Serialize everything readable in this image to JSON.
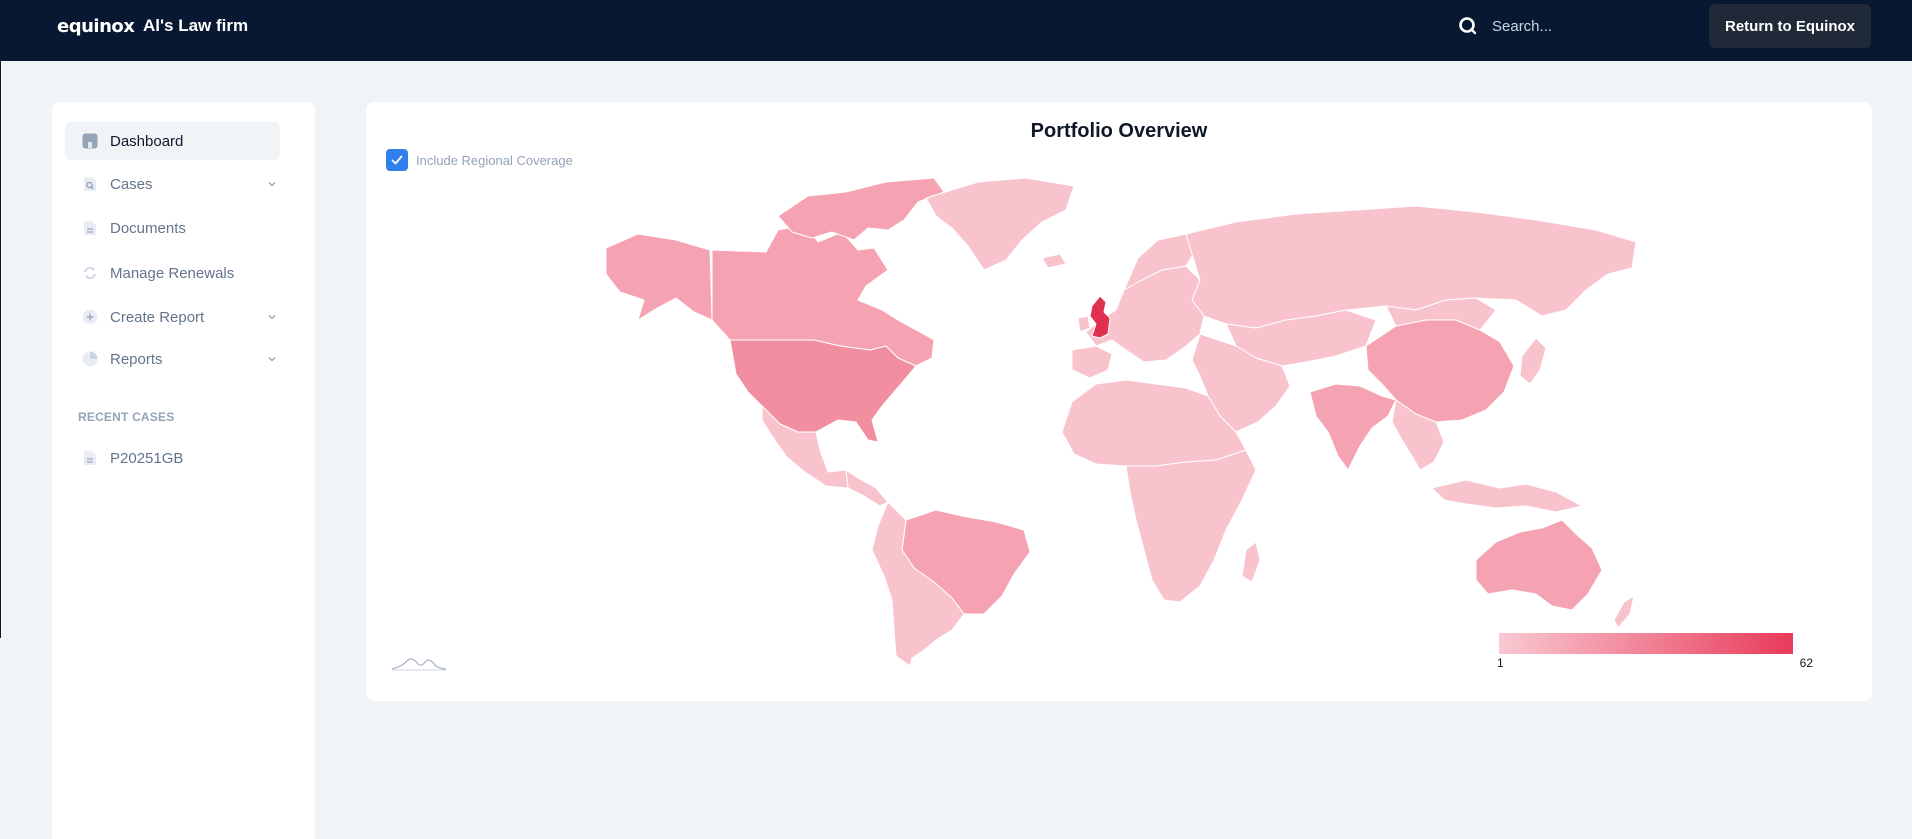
{
  "header": {
    "logo_text": "equinox",
    "app_title": "Al's Law firm",
    "search_placeholder": "Search...",
    "return_button": "Return to Equinox"
  },
  "sidebar": {
    "items": [
      {
        "label": "Dashboard",
        "icon": "dashboard-icon",
        "active": true,
        "has_chevron": false
      },
      {
        "label": "Cases",
        "icon": "cases-icon",
        "active": false,
        "has_chevron": true
      },
      {
        "label": "Documents",
        "icon": "document-icon",
        "active": false,
        "has_chevron": false
      },
      {
        "label": "Manage Renewals",
        "icon": "renew-icon",
        "active": false,
        "has_chevron": false
      },
      {
        "label": "Create Report",
        "icon": "plus-icon",
        "active": false,
        "has_chevron": true
      },
      {
        "label": "Reports",
        "icon": "pie-chart-icon",
        "active": false,
        "has_chevron": true
      }
    ],
    "recent_heading": "RECENT CASES",
    "recent_cases": [
      {
        "label": "P20251GB",
        "icon": "document-icon"
      }
    ]
  },
  "main": {
    "title": "Portfolio Overview",
    "checkbox_label": "Include Regional Coverage",
    "checkbox_checked": true,
    "legend": {
      "min": "1",
      "max": "62",
      "color_min": "#f9c9d2",
      "color_max": "#e83b5a"
    }
  },
  "colors": {
    "topbar": "#081833",
    "accent": "#2f80ed",
    "map_light": "#f9c3cd",
    "map_medium": "#f5a3b2",
    "map_strong": "#f18ea0",
    "map_highlight": "#e0304f"
  }
}
